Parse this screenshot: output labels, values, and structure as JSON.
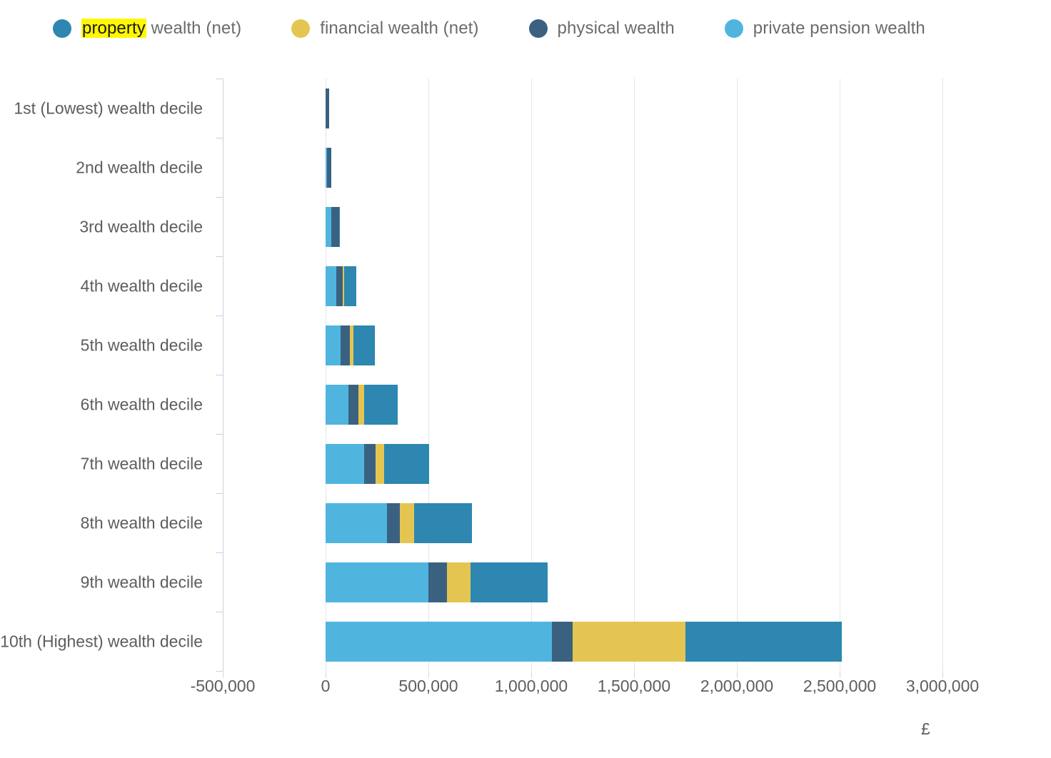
{
  "legend": {
    "items": [
      {
        "label_pre": "property",
        "label_post": " wealth (net)",
        "highlighted": true,
        "color": "#2d87b0",
        "key": "property"
      },
      {
        "label_pre": "",
        "label_post": "financial wealth (net)",
        "highlighted": false,
        "color": "#e5c551",
        "key": "financial"
      },
      {
        "label_pre": "",
        "label_post": "physical wealth",
        "highlighted": false,
        "color": "#3b6181",
        "key": "physical"
      },
      {
        "label_pre": "",
        "label_post": "private pension wealth",
        "highlighted": false,
        "color": "#4fb5df",
        "key": "pension"
      }
    ]
  },
  "axis": {
    "x_unit": "£",
    "x_ticks": [
      "-500,000",
      "0",
      "500,000",
      "1,000,000",
      "1,500,000",
      "2,000,000",
      "2,500,000",
      "3,000,000"
    ],
    "x_tick_values": [
      -500000,
      0,
      500000,
      1000000,
      1500000,
      2000000,
      2500000,
      3000000
    ],
    "x_min": -500000,
    "x_max": 3000000
  },
  "chart_data": {
    "type": "bar",
    "orientation": "horizontal",
    "stacked": true,
    "title": "",
    "xlabel": "£",
    "ylabel": "",
    "xlim": [
      -500000,
      3000000
    ],
    "grid": true,
    "legend_position": "top-left",
    "categories": [
      "1st (Lowest) wealth decile",
      "2nd wealth decile",
      "3rd wealth decile",
      "4th wealth decile",
      "5th wealth decile",
      "6th wealth decile",
      "7th wealth decile",
      "8th wealth decile",
      "9th wealth decile",
      "10th (Highest) wealth decile"
    ],
    "series": [
      {
        "name": "private pension wealth",
        "color": "#4fb5df",
        "values": [
          0,
          7000,
          28000,
          52000,
          73000,
          111000,
          187000,
          298000,
          500000,
          1100000
        ]
      },
      {
        "name": "physical wealth",
        "color": "#3b6181",
        "values": [
          17000,
          21000,
          38000,
          31000,
          45000,
          49000,
          56000,
          63000,
          90000,
          100000
        ]
      },
      {
        "name": "financial wealth (net)",
        "color": "#e5c551",
        "values": [
          0,
          0,
          0,
          9000,
          17000,
          27000,
          42000,
          69000,
          115000,
          550000
        ]
      },
      {
        "name": "property wealth (net)",
        "color": "#2d87b0",
        "values": [
          0,
          0,
          5000,
          59000,
          105000,
          164000,
          218000,
          282000,
          375000,
          760000
        ]
      }
    ],
    "series_order": [
      "pension",
      "physical",
      "financial",
      "property"
    ],
    "totals": [
      17000,
      28000,
      71000,
      151000,
      240000,
      351000,
      503000,
      712000,
      1080000,
      2510000
    ]
  }
}
